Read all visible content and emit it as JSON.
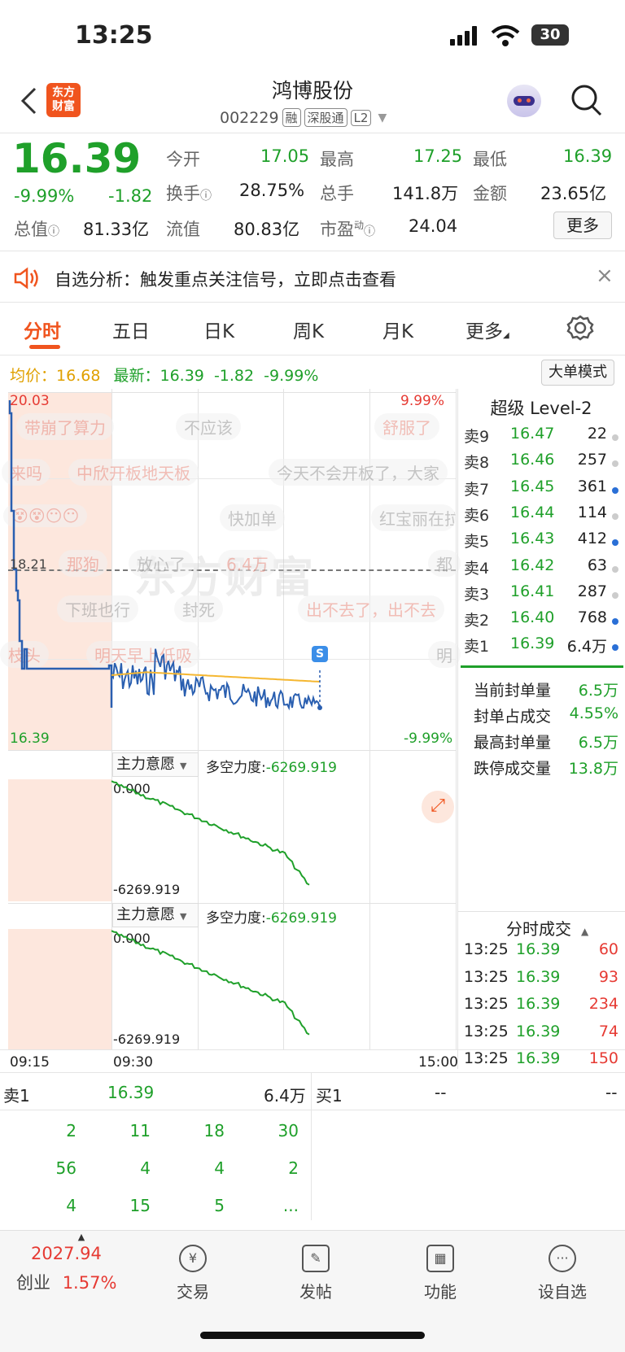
{
  "status_bar": {
    "time": "13:25",
    "battery": "30"
  },
  "header": {
    "logo_line1": "东方",
    "logo_line2": "财富",
    "name": "鸿博股份",
    "code": "002229",
    "tags": [
      "融",
      "深股通",
      "L2"
    ]
  },
  "quote": {
    "price": "16.39",
    "change_pct": "-9.99%",
    "change": "-1.82",
    "open_label": "今开",
    "open": "17.05",
    "high_label": "最高",
    "high": "17.25",
    "low_label": "最低",
    "low": "16.39",
    "turnover_label": "换手",
    "turnover": "28.75%",
    "volume_label": "总手",
    "volume": "141.8万",
    "amount_label": "金额",
    "amount": "23.65亿",
    "mktcap_label": "总值",
    "mktcap": "81.33亿",
    "float_label": "流值",
    "float": "80.83亿",
    "pe_label": "市盈",
    "pe_sup": "动",
    "pe": "24.04",
    "more": "更多"
  },
  "notice": {
    "text": "自选分析：触发重点关注信号，立即点击查看",
    "close": "×"
  },
  "tabs": [
    "分时",
    "五日",
    "日K",
    "周K",
    "月K",
    "更多"
  ],
  "chart_header": {
    "avg_label": "均价：",
    "avg": "16.68",
    "latest_label": "最新：",
    "latest": "16.39",
    "latest_change": "-1.82",
    "latest_pct": "-9.99%",
    "big_order_mode": "大单模式"
  },
  "intraday": {
    "y_top": "20.03",
    "y_top_pct": "9.99%",
    "y_mid": "18.21",
    "y_bottom": "16.39",
    "y_bottom_pct": "-9.99%",
    "x_labels": [
      "09:15",
      "09:30",
      "15:00"
    ],
    "s_badge": "S"
  },
  "danmaku": [
    "带崩了算力",
    "不应该",
    "舒服了",
    "来吗",
    "中欣开板地天板",
    "今天不会开板了，大家",
    "快加单",
    "红宝丽在拉",
    "那狗",
    "放心了",
    "6.4万",
    "都",
    "下班也行",
    "封死",
    "出不去了，出不去",
    "枝头",
    "明天早上低吸",
    "明"
  ],
  "watermark_logo": "东方财富",
  "indicator1": {
    "label": "主力意愿",
    "force_label": "多空力度:",
    "force": "-6269.919",
    "top": "0.000",
    "bottom": "-6269.919"
  },
  "indicator2": {
    "label": "主力意愿",
    "force_label": "多空力度:",
    "force": "-6269.919",
    "top": "0.000",
    "bottom": "-6269.919"
  },
  "level2": {
    "title": "超级 Level-2",
    "asks": [
      {
        "label": "卖9",
        "price": "16.47",
        "vol": "22",
        "dot": "#cccccc"
      },
      {
        "label": "卖8",
        "price": "16.46",
        "vol": "257",
        "dot": "#cccccc"
      },
      {
        "label": "卖7",
        "price": "16.45",
        "vol": "361",
        "dot": "#2a6fd6"
      },
      {
        "label": "卖6",
        "price": "16.44",
        "vol": "114",
        "dot": "#cccccc"
      },
      {
        "label": "卖5",
        "price": "16.43",
        "vol": "412",
        "dot": "#2a6fd6"
      },
      {
        "label": "卖4",
        "price": "16.42",
        "vol": "63",
        "dot": "#cccccc"
      },
      {
        "label": "卖3",
        "price": "16.41",
        "vol": "287",
        "dot": "#cccccc"
      },
      {
        "label": "卖2",
        "price": "16.40",
        "vol": "768",
        "dot": "#2a6fd6"
      },
      {
        "label": "卖1",
        "price": "16.39",
        "vol": "6.4万",
        "dot": "#2a6fd6"
      }
    ],
    "seal_stats": [
      {
        "label": "当前封单量",
        "value": "6.5万"
      },
      {
        "label": "封单占成交",
        "value": "4.55%"
      },
      {
        "label": "最高封单量",
        "value": "6.5万"
      },
      {
        "label": "跌停成交量",
        "value": "13.8万"
      }
    ],
    "trades_title": "分时成交",
    "trades": [
      {
        "time": "13:25",
        "price": "16.39",
        "vol": "60"
      },
      {
        "time": "13:25",
        "price": "16.39",
        "vol": "93"
      },
      {
        "time": "13:25",
        "price": "16.39",
        "vol": "234"
      },
      {
        "time": "13:25",
        "price": "16.39",
        "vol": "74"
      },
      {
        "time": "13:25",
        "price": "16.39",
        "vol": "150"
      }
    ]
  },
  "order_book": {
    "sell1_label": "卖1",
    "sell1_price": "16.39",
    "sell1_vol": "6.4万",
    "buy1_label": "买1",
    "buy1_price": "--",
    "buy1_vol": "--",
    "queue": [
      "2",
      "11",
      "18",
      "30",
      "56",
      "4",
      "4",
      "2",
      "4",
      "15",
      "5",
      "..."
    ]
  },
  "bottom_nav": {
    "index_value": "2027.94",
    "index_name": "创业",
    "index_pct": "1.57%",
    "items": [
      "交易",
      "发帖",
      "功能",
      "设自选"
    ]
  },
  "colors": {
    "up": "#e63a33",
    "down": "#1fa02a",
    "accent": "#f0541e",
    "price_line": "#2a5fb0",
    "avg_line": "#f5b731"
  }
}
